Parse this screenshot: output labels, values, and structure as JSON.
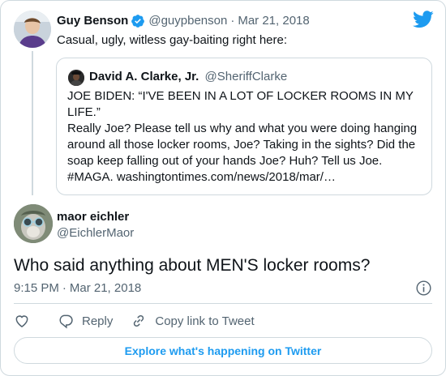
{
  "parent_tweet": {
    "name": "Guy Benson",
    "handle": "@guypbenson",
    "separator": "·",
    "date": "Mar 21, 2018",
    "text": "Casual, ugly, witless gay-baiting right here:",
    "avatar_icon": "profile-photo-guy-benson",
    "verified_icon": "verified-badge-icon"
  },
  "quoted_tweet": {
    "name": "David A. Clarke, Jr.",
    "handle": "@SheriffClarke",
    "lines": [
      "JOE BIDEN: “I'VE BEEN IN A LOT OF LOCKER ROOMS IN MY LIFE.”",
      "Really Joe? Please tell us why and what you were doing hanging around all those locker rooms, Joe? Taking in the sights? Did the soap keep falling out of your hands Joe? Huh? Tell us Joe. #MAGA. washingtontimes.com/news/2018/mar/…"
    ]
  },
  "main_tweet": {
    "name": "maor eichler",
    "handle": "@EichlerMaor",
    "text": "Who said anything about MEN'S locker rooms?",
    "time": "9:15 PM",
    "separator": "·",
    "date": "Mar 21, 2018"
  },
  "actions": {
    "like_icon": "heart-icon",
    "reply_label": "Reply",
    "copy_label": "Copy link to Tweet"
  },
  "explore_label": "Explore what's happening on Twitter",
  "colors": {
    "accent": "#1d9bf0",
    "text": "#0f1419",
    "muted": "#536471",
    "border": "#cfd9de"
  }
}
